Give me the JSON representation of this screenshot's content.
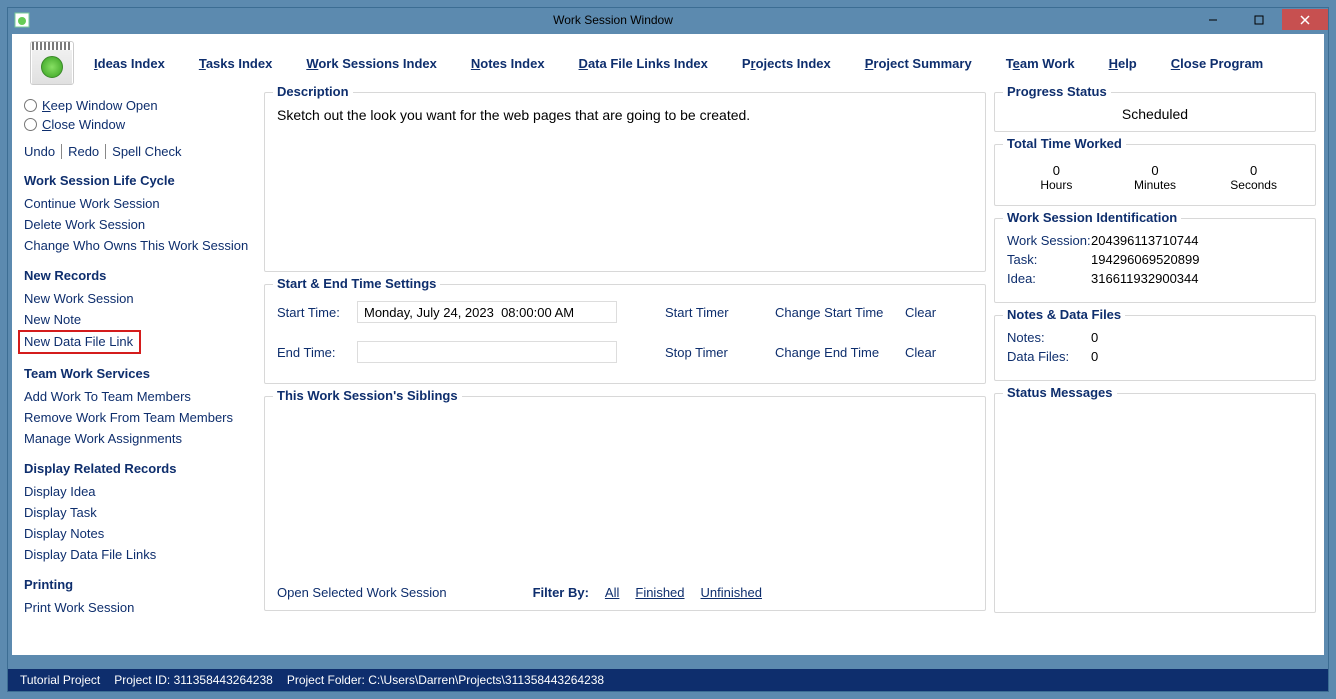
{
  "window": {
    "title": "Work Session Window"
  },
  "menu": {
    "ideas_index": "Ideas Index",
    "tasks_index": "Tasks Index",
    "work_sessions_index": "Work Sessions Index",
    "notes_index": "Notes Index",
    "data_file_links_index": "Data File Links Index",
    "projects_index": "Projects Index",
    "project_summary": "Project Summary",
    "team_work": "Team Work",
    "help": "Help",
    "close_program": "Close Program"
  },
  "sidebar": {
    "keep_window_open": "Keep Window Open",
    "close_window": "Close Window",
    "undo": "Undo",
    "redo": "Redo",
    "spell_check": "Spell Check",
    "groups": {
      "life_cycle": {
        "title": "Work Session Life Cycle",
        "continue": "Continue Work Session",
        "delete": "Delete Work Session",
        "change_owner": "Change Who Owns This Work Session"
      },
      "new_records": {
        "title": "New Records",
        "new_ws": "New Work Session",
        "new_note": "New Note",
        "new_dfl": "New Data File Link"
      },
      "team_work": {
        "title": "Team Work Services",
        "add": "Add Work To Team Members",
        "remove": "Remove Work From Team Members",
        "manage": "Manage Work Assignments"
      },
      "display": {
        "title": "Display Related Records",
        "idea": "Display Idea",
        "task": "Display Task",
        "notes": "Display Notes",
        "dfl": "Display Data File Links"
      },
      "printing": {
        "title": "Printing",
        "print": "Print Work Session"
      }
    }
  },
  "main": {
    "description": {
      "legend": "Description",
      "text": "Sketch out the look you want for the web pages that are going to be created."
    },
    "time": {
      "legend": "Start & End Time Settings",
      "start_label": "Start Time:",
      "start_value": "Monday, July 24, 2023  08:00:00 AM",
      "start_timer": "Start Timer",
      "change_start": "Change Start Time",
      "clear_start": "Clear",
      "end_label": "End Time:",
      "end_value": "",
      "stop_timer": "Stop Timer",
      "change_end": "Change End Time",
      "clear_end": "Clear"
    },
    "siblings": {
      "legend": "This Work Session's Siblings",
      "open": "Open Selected Work Session",
      "filter_by": "Filter By:",
      "all": "All",
      "finished": "Finished",
      "unfinished": "Unfinished"
    }
  },
  "right": {
    "progress": {
      "legend": "Progress Status",
      "value": "Scheduled"
    },
    "time_worked": {
      "legend": "Total Time Worked",
      "hours_val": "0",
      "hours_label": "Hours",
      "minutes_val": "0",
      "minutes_label": "Minutes",
      "seconds_val": "0",
      "seconds_label": "Seconds"
    },
    "identification": {
      "legend": "Work Session Identification",
      "ws_label": "Work Session:",
      "ws_val": "204396113710744",
      "task_label": "Task:",
      "task_val": "194296069520899",
      "idea_label": "Idea:",
      "idea_val": "316611932900344"
    },
    "notes_files": {
      "legend": "Notes & Data Files",
      "notes_label": "Notes:",
      "notes_val": "0",
      "files_label": "Data Files:",
      "files_val": "0"
    },
    "status_messages": {
      "legend": "Status Messages"
    }
  },
  "statusbar": {
    "project_name": "Tutorial Project",
    "project_id": "Project ID: 311358443264238",
    "project_folder": "Project Folder: C:\\Users\\Darren\\Projects\\311358443264238"
  }
}
